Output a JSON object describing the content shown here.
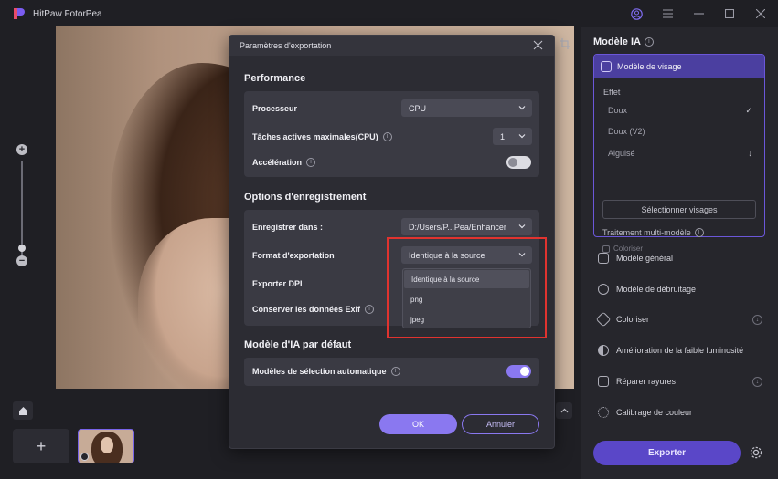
{
  "app": {
    "title": "HitPaw FotorPea"
  },
  "right_panel": {
    "title": "Modèle IA",
    "face_model": {
      "label": "Modèle de visage",
      "effect_label": "Effet",
      "effects": [
        {
          "label": "Doux",
          "selected": true
        },
        {
          "label": "Doux (V2)",
          "selected": false
        },
        {
          "label": "Aiguisé",
          "selected": false
        }
      ],
      "select_faces": "Sélectionner visages",
      "multi_label": "Traitement multi-modèle",
      "colorize_checkbox": "Coloriser"
    },
    "models": [
      {
        "label": "Modèle général",
        "icon": "image-icon",
        "download": false
      },
      {
        "label": "Modèle de débruitage",
        "icon": "denoise-icon",
        "download": false
      },
      {
        "label": "Coloriser",
        "icon": "brush-icon",
        "download": true
      },
      {
        "label": "Amélioration de la faible luminosité",
        "icon": "half-circle-icon",
        "download": false
      },
      {
        "label": "Réparer rayures",
        "icon": "repair-icon",
        "download": true
      },
      {
        "label": "Calibrage de couleur",
        "icon": "sun-icon",
        "download": false
      }
    ],
    "export_button": "Exporter"
  },
  "modal": {
    "title": "Paramètres d'exportation",
    "performance": {
      "section_title": "Performance",
      "processor_label": "Processeur",
      "processor_value": "CPU",
      "tasks_label": "Tâches actives maximales(CPU)",
      "tasks_value": "1",
      "accel_label": "Accélération",
      "accel_on": false
    },
    "save_options": {
      "section_title": "Options d'enregistrement",
      "save_in_label": "Enregistrer dans :",
      "save_in_value": "D:/Users/P...Pea/Enhancer",
      "format_label": "Format d'exportation",
      "format_value": "Identique à la source",
      "format_options": [
        "Identique à la source",
        "png",
        "jpeg"
      ],
      "dpi_label": "Exporter DPI",
      "exif_label": "Conserver les données Exif"
    },
    "default_model": {
      "section_title": "Modèle d'IA par défaut",
      "auto_label": "Modèles de sélection automatique",
      "auto_on": true
    },
    "ok_label": "OK",
    "cancel_label": "Annuler"
  },
  "colors": {
    "accent": "#8a78f0",
    "accent_dark": "#5a47c8",
    "highlight_frame": "#e0332f"
  }
}
